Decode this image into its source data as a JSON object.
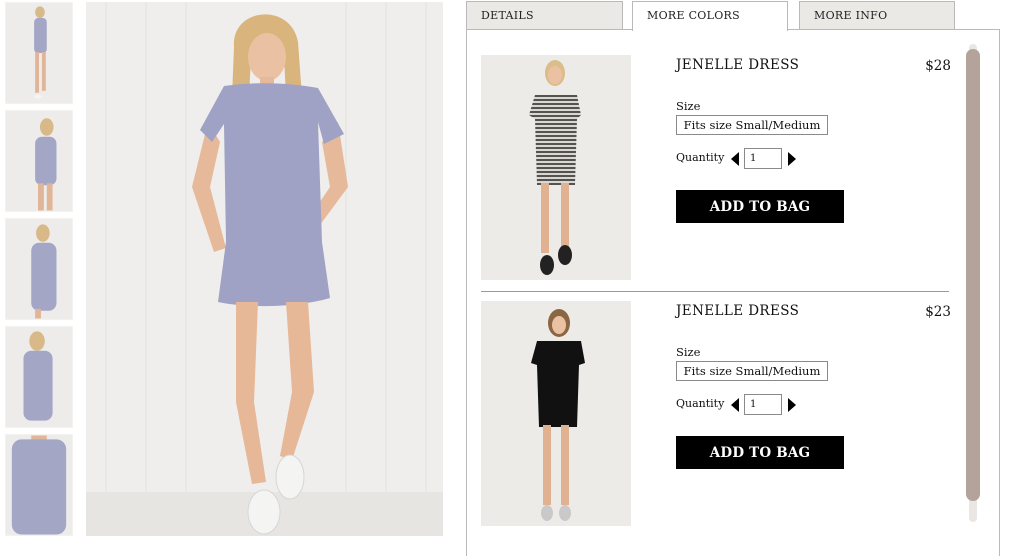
{
  "thumbnails": [
    {
      "alt": "",
      "icon": "model-thumbnail-icon"
    },
    {
      "alt": "",
      "icon": "model-thumbnail-icon"
    },
    {
      "alt": "",
      "icon": "model-thumbnail-icon"
    },
    {
      "alt": "",
      "icon": "model-thumbnail-icon"
    },
    {
      "alt": "",
      "icon": "model-thumbnail-icon"
    }
  ],
  "tabs": {
    "details": "DETAILS",
    "more_colors": "MORE COLORS",
    "more_info": "MORE INFO",
    "active": "more_colors"
  },
  "products": [
    {
      "name": "JENELLE DRESS",
      "price": "$28",
      "size_label": "Size",
      "size_value": "Fits size Small/Medium",
      "quantity_label": "Quantity",
      "quantity": "1",
      "add_label": "ADD TO BAG",
      "dress_color": "striped grey"
    },
    {
      "name": "JENELLE DRESS",
      "price": "$23",
      "size_label": "Size",
      "size_value": "Fits size Small/Medium",
      "quantity_label": "Quantity",
      "quantity": "1",
      "add_label": "ADD TO BAG",
      "dress_color": "black"
    }
  ],
  "colors": {
    "tab_bg": "#ebe9e6",
    "button_bg": "#000000",
    "scroll_thumb": "#b3a39b",
    "main_dress": "#9fa2c4"
  }
}
